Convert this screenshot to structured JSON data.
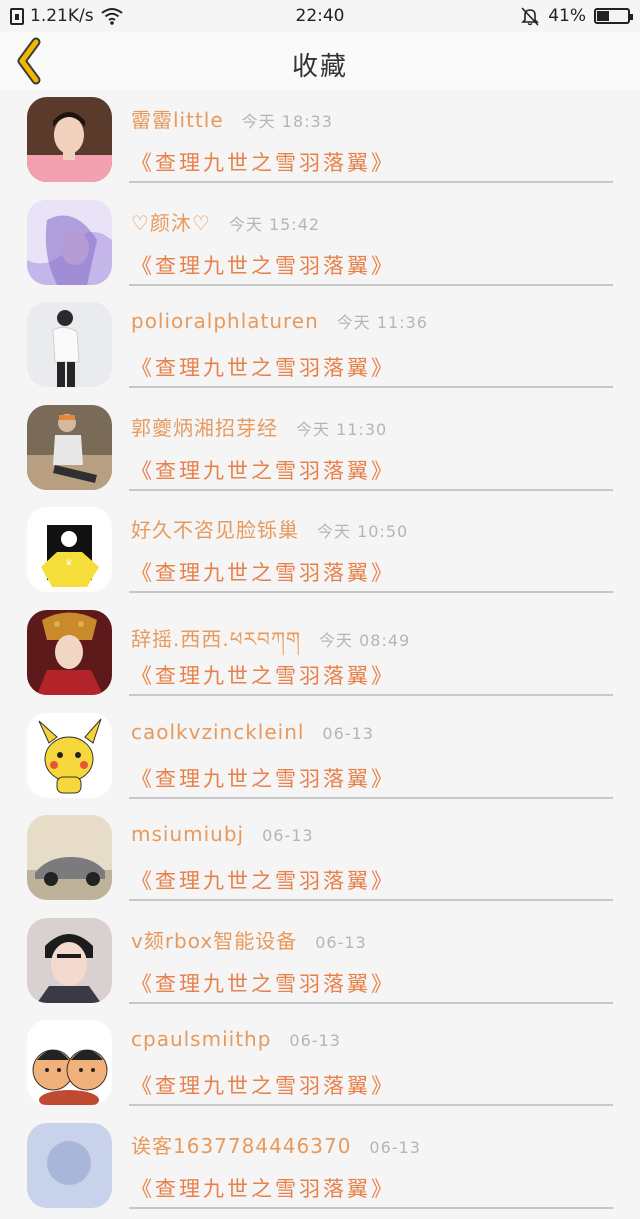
{
  "status_bar": {
    "network_speed": "1.21K/s",
    "time": "22:40",
    "battery_percent": "41%",
    "battery_level": 0.41
  },
  "header": {
    "title": "收藏",
    "back_icon": "chevron-left-icon",
    "accent_color": "#f0b800"
  },
  "colors": {
    "name": "#e89a5c",
    "book": "#e8804a",
    "time": "#b5b5b5"
  },
  "favorites": [
    {
      "name": "霤霤little",
      "time": "今天 18:33",
      "book": "《查理九世之雪羽落翼》"
    },
    {
      "name": "♡颜沐♡",
      "time": "今天 15:42",
      "book": "《查理九世之雪羽落翼》"
    },
    {
      "name": "polioralphlaturen",
      "time": "今天 11:36",
      "book": "《查理九世之雪羽落翼》"
    },
    {
      "name": "郭夔炳湘招芽经",
      "time": "今天 11:30",
      "book": "《查理九世之雪羽落翼》"
    },
    {
      "name": "好久不咨见脸铄巢",
      "time": "今天 10:50",
      "book": "《查理九世之雪羽落翼》"
    },
    {
      "name": "辞摇.西西.ཕརབཀག",
      "time": "今天 08:49",
      "book": "《查理九世之雪羽落翼》"
    },
    {
      "name": "caolkvzinckleinl",
      "time": "06-13",
      "book": "《查理九世之雪羽落翼》"
    },
    {
      "name": "msiumiubj",
      "time": "06-13",
      "book": "《查理九世之雪羽落翼》"
    },
    {
      "name": "v颏rbox智能设备",
      "time": "06-13",
      "book": "《查理九世之雪羽落翼》"
    },
    {
      "name": "cpaulsmiithp",
      "time": "06-13",
      "book": "《查理九世之雪羽落翼》"
    },
    {
      "name": "诶客1637784446370",
      "time": "06-13",
      "book": "《查理九世之雪羽落翼》"
    }
  ]
}
